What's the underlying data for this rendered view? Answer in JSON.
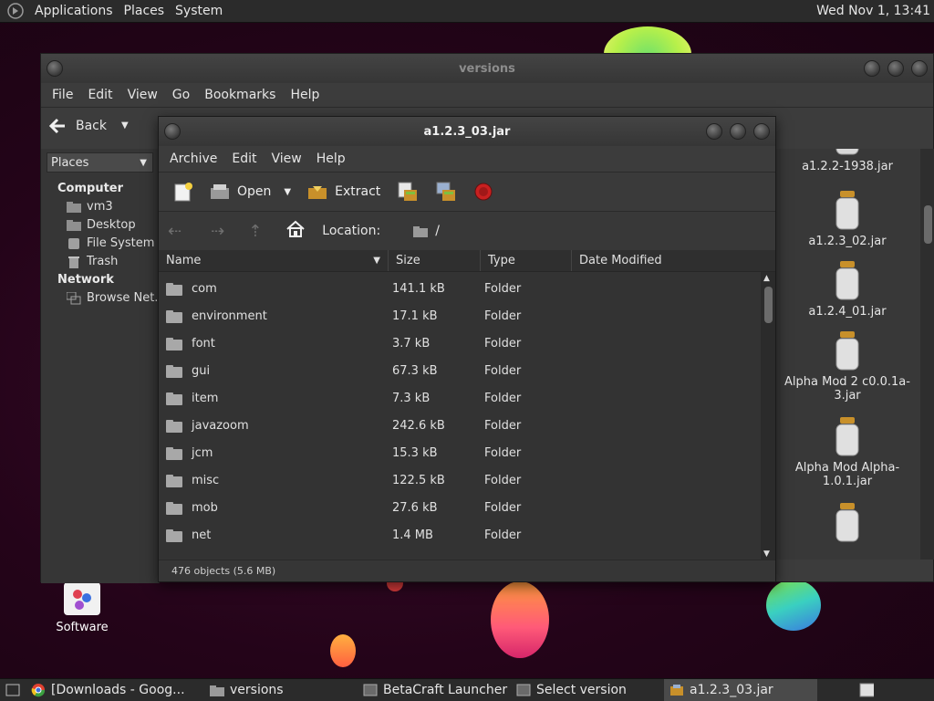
{
  "top_panel": {
    "menus": [
      "Applications",
      "Places",
      "System"
    ],
    "clock": "Wed Nov 1, 13:41"
  },
  "desktop": {
    "software_label": "Software"
  },
  "versions_window": {
    "title": "versions",
    "menu": [
      "File",
      "Edit",
      "View",
      "Go",
      "Bookmarks",
      "Help"
    ],
    "back_label": "Back",
    "places_select": "Places",
    "sidebar": {
      "computer_header": "Computer",
      "computer_items": [
        "vm3",
        "Desktop",
        "File System",
        "Trash"
      ],
      "network_header": "Network",
      "network_items": [
        "Browse Net..."
      ]
    },
    "icon_items": [
      "a1.2.2-1938.jar",
      "a1.2.3_02.jar",
      "a1.2.4_01.jar",
      "Alpha Mod 2 c0.0.1a-3.jar",
      "Alpha Mod Alpha-1.0.1.jar"
    ]
  },
  "archive_window": {
    "title": "a1.2.3_03.jar",
    "menu": [
      "Archive",
      "Edit",
      "View",
      "Help"
    ],
    "toolbar": {
      "open_label": "Open",
      "extract_label": "Extract"
    },
    "location_label": "Location:",
    "location_value": "/",
    "columns": [
      "Name",
      "Size",
      "Type",
      "Date Modified"
    ],
    "rows": [
      {
        "name": "com",
        "size": "141.1 kB",
        "type": "Folder"
      },
      {
        "name": "environment",
        "size": "17.1 kB",
        "type": "Folder"
      },
      {
        "name": "font",
        "size": "3.7 kB",
        "type": "Folder"
      },
      {
        "name": "gui",
        "size": "67.3 kB",
        "type": "Folder"
      },
      {
        "name": "item",
        "size": "7.3 kB",
        "type": "Folder"
      },
      {
        "name": "javazoom",
        "size": "242.6 kB",
        "type": "Folder"
      },
      {
        "name": "jcm",
        "size": "15.3 kB",
        "type": "Folder"
      },
      {
        "name": "misc",
        "size": "122.5 kB",
        "type": "Folder"
      },
      {
        "name": "mob",
        "size": "27.6 kB",
        "type": "Folder"
      },
      {
        "name": "net",
        "size": "1.4 MB",
        "type": "Folder"
      }
    ],
    "status": "476 objects (5.6 MB)"
  },
  "taskbar": {
    "tasks": [
      "[Downloads - Goog...",
      "versions",
      "BetaCraft Launcher ...",
      "Select version",
      "a1.2.3_03.jar"
    ]
  }
}
